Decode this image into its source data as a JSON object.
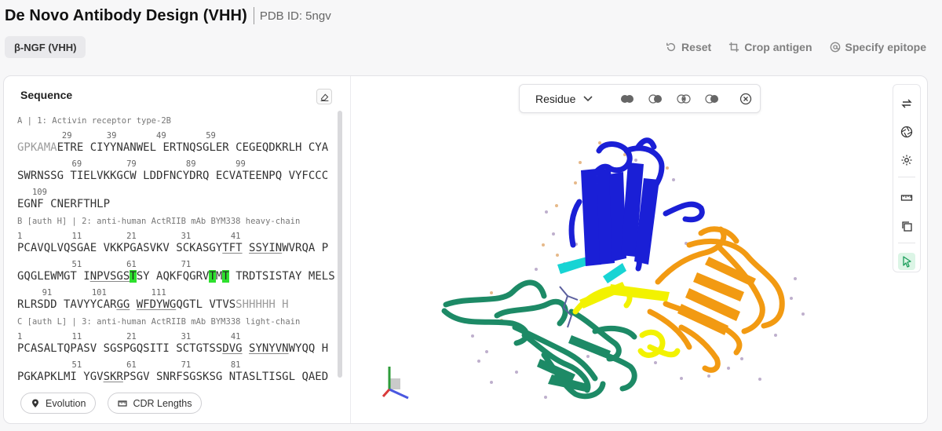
{
  "header": {
    "title": "De Novo Antibody Design (VHH)",
    "pdb": "PDB ID: 5ngv"
  },
  "target_chip": "β-NGF (VHH)",
  "toolbar": {
    "reset": "Reset",
    "crop": "Crop antigen",
    "epitope": "Specify epitope"
  },
  "sequence_panel": {
    "title": "Sequence",
    "chains": [
      {
        "label": "A | 1: Activin receptor type-2B",
        "rows": [
          {
            "nums": "         29       39        49        59",
            "res": "GPKAMAETRE CIYYNANWEL ERTNQSGLER CEGEQDKRLH CYA"
          },
          {
            "nums": "           69         79          89        99",
            "res": "SWRNSSG TIELVKKGCW LDDFNCYDRQ ECVATEENPQ VYFCCC"
          },
          {
            "nums": "   109",
            "res": "EGNF CNERFTHLP"
          }
        ]
      },
      {
        "label": "B [auth H] | 2: anti-human ActRIIB mAb BYM338 heavy-chain",
        "rows": [
          {
            "nums": "1          11         21         31        41",
            "res": "PCAVQLVQSGAE VKKPGASVKV SCKASGYTFT SSYINWVRQA P"
          },
          {
            "nums": "           51         61         71",
            "res": "GQGLEWMGT INPVSGSTSY AQKFQGRVTMT TRDTSISTAY MELS"
          },
          {
            "nums": "     91        101         111",
            "res": "RLRSDD TAVYYCARGG WFDYWGQGTL VTVSSHHHHH H"
          }
        ]
      },
      {
        "label": "C [auth L] | 3: anti-human ActRIIB mAb BYM338 light-chain",
        "rows": [
          {
            "nums": "1          11         21         31        41",
            "res": "PCASALTQPASV SGSPGQSITI SCTGTSSDVG SYNYVNWYQQ H"
          },
          {
            "nums": "           51         61         71        81",
            "res": "PGKAPKLMI YGVSKRPSGV SNRFSGSKSG NTASLTISGL QAED"
          }
        ]
      }
    ],
    "buttons": {
      "evolution": "Evolution",
      "cdr": "CDR Lengths"
    }
  },
  "viewer": {
    "mode_select": "Residue",
    "icons": [
      "cartoon-icon",
      "surface-toggle-icon",
      "ball-stick-icon",
      "spacefill-icon",
      "clear-icon"
    ],
    "side_tools": [
      "swap-icon",
      "aperture-icon",
      "settings-icon",
      "ruler-icon",
      "copy-icon",
      "pointer-icon"
    ],
    "colors": {
      "chain_a": "#1a1fd6",
      "chain_b": "#f29a12",
      "chain_c": "#1d8a66",
      "cdr_yellow": "#f2f200",
      "cdr_cyan": "#17d4d4"
    }
  }
}
